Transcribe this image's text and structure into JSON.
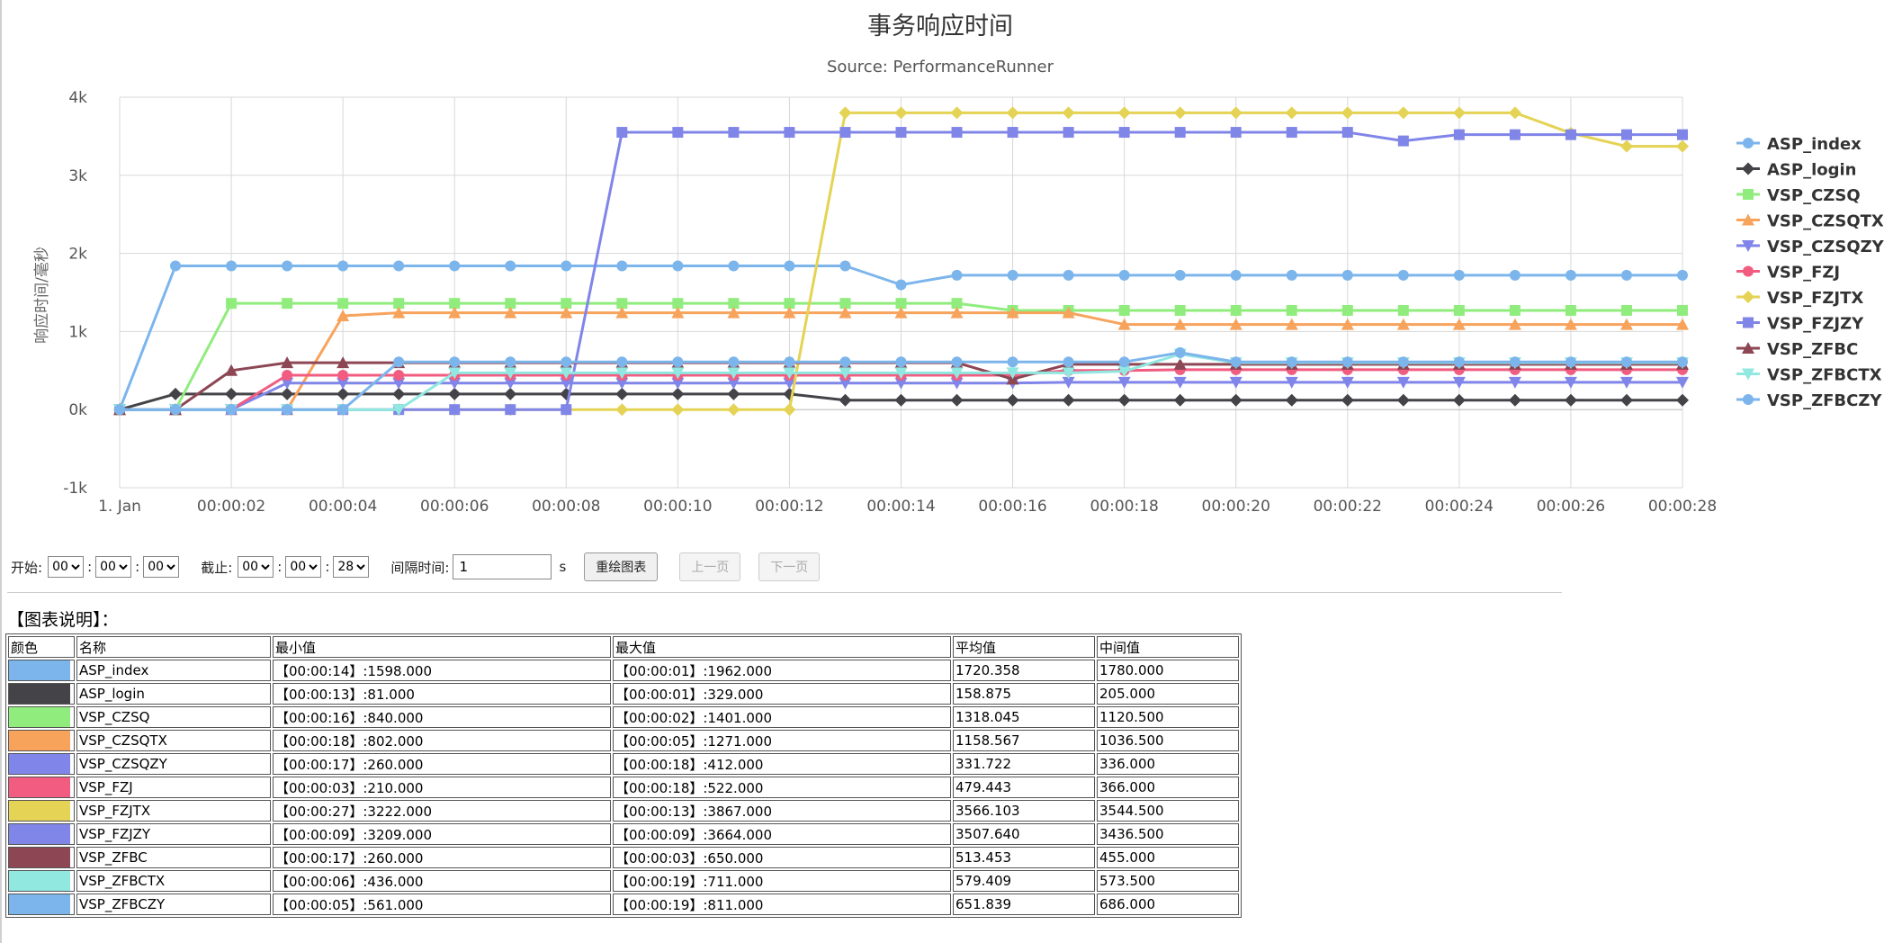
{
  "chart_data": {
    "type": "line",
    "title": "事务响应时间",
    "subtitle": "Source: PerformanceRunner",
    "ylabel": "响应时间/毫秒",
    "ylim": [
      -1000,
      4000
    ],
    "yticks": [
      -1000,
      0,
      1000,
      2000,
      3000,
      4000
    ],
    "ytick_labels": [
      "-1k",
      "0k",
      "1k",
      "2k",
      "3k",
      "4k"
    ],
    "xtick_labels": [
      "1. Jan",
      "00:00:02",
      "00:00:04",
      "00:00:06",
      "00:00:08",
      "00:00:10",
      "00:00:12",
      "00:00:14",
      "00:00:16",
      "00:00:18",
      "00:00:20",
      "00:00:22",
      "00:00:24",
      "00:00:26",
      "00:00:28"
    ],
    "x": [
      0,
      1,
      2,
      3,
      4,
      5,
      6,
      7,
      8,
      9,
      10,
      11,
      12,
      13,
      14,
      15,
      16,
      17,
      18,
      19,
      20,
      21,
      22,
      23,
      24,
      25,
      26,
      27,
      28
    ],
    "grid": true,
    "legend_position": "right",
    "series": [
      {
        "name": "ASP_index",
        "color": "#7cb5ec",
        "marker": "circle",
        "values": [
          0,
          1840,
          1840,
          1840,
          1840,
          1840,
          1840,
          1840,
          1840,
          1840,
          1840,
          1840,
          1840,
          1840,
          1598,
          1720,
          1720,
          1720,
          1720,
          1720,
          1720,
          1720,
          1720,
          1720,
          1720,
          1720,
          1720,
          1720,
          1720
        ]
      },
      {
        "name": "ASP_login",
        "color": "#434348",
        "marker": "diamond",
        "values": [
          0,
          200,
          200,
          200,
          200,
          200,
          200,
          200,
          200,
          200,
          200,
          200,
          200,
          120,
          120,
          120,
          120,
          120,
          120,
          120,
          120,
          120,
          120,
          120,
          120,
          120,
          120,
          120,
          120
        ]
      },
      {
        "name": "VSP_CZSQ",
        "color": "#90ed7d",
        "marker": "square",
        "values": [
          0,
          0,
          1360,
          1360,
          1360,
          1360,
          1360,
          1360,
          1360,
          1360,
          1360,
          1360,
          1360,
          1360,
          1360,
          1360,
          1270,
          1270,
          1270,
          1270,
          1270,
          1270,
          1270,
          1270,
          1270,
          1270,
          1270,
          1270,
          1270
        ]
      },
      {
        "name": "VSP_CZSQTX",
        "color": "#f7a35c",
        "marker": "triangle",
        "values": [
          0,
          0,
          0,
          0,
          1200,
          1240,
          1240,
          1240,
          1240,
          1240,
          1240,
          1240,
          1240,
          1240,
          1240,
          1240,
          1240,
          1240,
          1090,
          1090,
          1090,
          1090,
          1090,
          1090,
          1090,
          1090,
          1090,
          1090,
          1090
        ]
      },
      {
        "name": "VSP_CZSQZY",
        "color": "#8085e9",
        "marker": "triangle-down",
        "values": [
          0,
          0,
          0,
          340,
          340,
          340,
          340,
          340,
          340,
          340,
          340,
          340,
          340,
          340,
          340,
          340,
          340,
          350,
          350,
          350,
          350,
          350,
          350,
          350,
          350,
          350,
          350,
          350,
          350
        ]
      },
      {
        "name": "VSP_FZJ",
        "color": "#f15c80",
        "marker": "circle",
        "values": [
          0,
          0,
          0,
          440,
          440,
          440,
          440,
          440,
          440,
          440,
          440,
          440,
          440,
          440,
          440,
          440,
          440,
          500,
          500,
          510,
          510,
          510,
          510,
          510,
          510,
          510,
          510,
          510,
          510
        ]
      },
      {
        "name": "VSP_FZJTX",
        "color": "#e4d354",
        "marker": "diamond",
        "values": [
          0,
          0,
          0,
          0,
          0,
          0,
          0,
          0,
          0,
          0,
          0,
          0,
          0,
          3800,
          3800,
          3800,
          3800,
          3800,
          3800,
          3800,
          3800,
          3800,
          3800,
          3800,
          3800,
          3800,
          3540,
          3370,
          3370
        ]
      },
      {
        "name": "VSP_FZJZY",
        "color": "#8085e8",
        "marker": "square",
        "values": [
          0,
          0,
          0,
          0,
          0,
          0,
          0,
          0,
          0,
          3550,
          3550,
          3550,
          3550,
          3550,
          3550,
          3550,
          3550,
          3550,
          3550,
          3550,
          3550,
          3550,
          3550,
          3440,
          3520,
          3520,
          3520,
          3520,
          3520
        ]
      },
      {
        "name": "VSP_ZFBC",
        "color": "#8d4653",
        "marker": "triangle",
        "values": [
          0,
          0,
          500,
          600,
          600,
          600,
          600,
          600,
          600,
          600,
          600,
          600,
          600,
          600,
          600,
          600,
          390,
          580,
          580,
          580,
          580,
          580,
          580,
          580,
          580,
          580,
          580,
          580,
          580
        ]
      },
      {
        "name": "VSP_ZFBCTX",
        "color": "#91e8e1",
        "marker": "triangle-down",
        "values": [
          0,
          0,
          0,
          0,
          0,
          0,
          470,
          470,
          470,
          470,
          470,
          470,
          470,
          470,
          470,
          470,
          470,
          470,
          490,
          710,
          600,
          600,
          600,
          600,
          600,
          600,
          600,
          600,
          600
        ]
      },
      {
        "name": "VSP_ZFBCZY",
        "color": "#7cb5ec",
        "marker": "circle",
        "values": [
          0,
          0,
          0,
          0,
          0,
          610,
          610,
          610,
          610,
          610,
          610,
          610,
          610,
          610,
          610,
          610,
          610,
          610,
          610,
          730,
          610,
          610,
          610,
          610,
          610,
          610,
          610,
          610,
          610
        ]
      }
    ]
  },
  "controls": {
    "start_label": "开始:",
    "end_label": "截止:",
    "interval_label": "间隔时间:",
    "colon": ":",
    "start_h": "00",
    "start_m": "00",
    "start_s": "00",
    "end_h": "00",
    "end_m": "00",
    "end_s": "28",
    "interval_value": "1",
    "unit": "s",
    "redraw_button": "重绘图表",
    "prev_button": "上一页",
    "next_button": "下一页"
  },
  "legend_section": {
    "title": "【图表说明】：",
    "headers": [
      "颜色",
      "名称",
      "最小值",
      "最大值",
      "平均值",
      "中间值"
    ],
    "rows": [
      {
        "color": "#7cb5ec",
        "name": "ASP_index",
        "min": "【00:00:14】:1598.000",
        "max": "【00:00:01】:1962.000",
        "avg": "1720.358",
        "median": "1780.000"
      },
      {
        "color": "#434348",
        "name": "ASP_login",
        "min": "【00:00:13】:81.000",
        "max": "【00:00:01】:329.000",
        "avg": "158.875",
        "median": "205.000"
      },
      {
        "color": "#90ed7d",
        "name": "VSP_CZSQ",
        "min": "【00:00:16】:840.000",
        "max": "【00:00:02】:1401.000",
        "avg": "1318.045",
        "median": "1120.500"
      },
      {
        "color": "#f7a35c",
        "name": "VSP_CZSQTX",
        "min": "【00:00:18】:802.000",
        "max": "【00:00:05】:1271.000",
        "avg": "1158.567",
        "median": "1036.500"
      },
      {
        "color": "#8085e9",
        "name": "VSP_CZSQZY",
        "min": "【00:00:17】:260.000",
        "max": "【00:00:18】:412.000",
        "avg": "331.722",
        "median": "336.000"
      },
      {
        "color": "#f15c80",
        "name": "VSP_FZJ",
        "min": "【00:00:03】:210.000",
        "max": "【00:00:18】:522.000",
        "avg": "479.443",
        "median": "366.000"
      },
      {
        "color": "#e4d354",
        "name": "VSP_FZJTX",
        "min": "【00:00:27】:3222.000",
        "max": "【00:00:13】:3867.000",
        "avg": "3566.103",
        "median": "3544.500"
      },
      {
        "color": "#8085e8",
        "name": "VSP_FZJZY",
        "min": "【00:00:09】:3209.000",
        "max": "【00:00:09】:3664.000",
        "avg": "3507.640",
        "median": "3436.500"
      },
      {
        "color": "#8d4653",
        "name": "VSP_ZFBC",
        "min": "【00:00:17】:260.000",
        "max": "【00:00:03】:650.000",
        "avg": "513.453",
        "median": "455.000"
      },
      {
        "color": "#91e8e1",
        "name": "VSP_ZFBCTX",
        "min": "【00:00:06】:436.000",
        "max": "【00:00:19】:711.000",
        "avg": "579.409",
        "median": "573.500"
      },
      {
        "color": "#7cb5ec",
        "name": "VSP_ZFBCZY",
        "min": "【00:00:05】:561.000",
        "max": "【00:00:19】:811.000",
        "avg": "651.839",
        "median": "686.000"
      }
    ]
  }
}
